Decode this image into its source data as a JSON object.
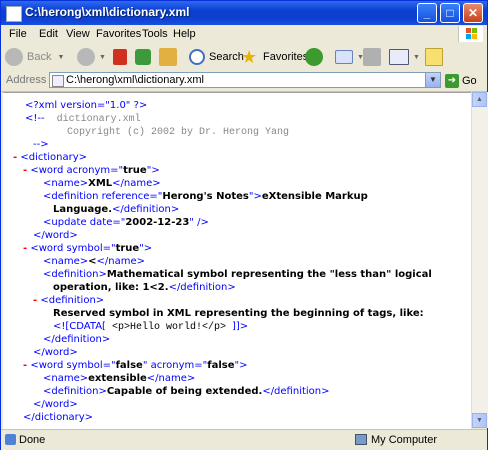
{
  "window": {
    "title": "C:\\herong\\xml\\dictionary.xml"
  },
  "menu": [
    "File",
    "Edit",
    "View",
    "Favorites",
    "Tools",
    "Help"
  ],
  "toolbar": {
    "back_label": "Back",
    "search_label": "Search",
    "favorites_label": "Favorites"
  },
  "address": {
    "label": "Address",
    "value": "C:\\herong\\xml\\dictionary.xml",
    "go_label": "Go"
  },
  "xml": {
    "l1": "<?xml version=\"1.0\" ?>",
    "l2_open": "<!--",
    "l2_text": "  dictionary.xml",
    "l3_text": "   Copyright (c) 2002 by Dr. Herong Yang",
    "l4_close": "-->",
    "dictionary_open": "<dictionary>",
    "word_acronym_open": "<word acronym=\"",
    "word_acronym_val": "true",
    "tag_close": "\">",
    "name_open": "<name>",
    "name_close": "</name>",
    "xml_word": "XML",
    "def_ref_open": "<definition reference=\"",
    "def_ref_val": "Herong's Notes",
    "def_open_tail": "\">",
    "def1_text_a": "eXtensible Markup",
    "def1_text_b": "Language.",
    "def_close": "</definition>",
    "update_open": "<update date=\"",
    "update_val": "2002-12-23",
    "update_close": "\" />",
    "word_close": "</word>",
    "word_symbol_open": "<word symbol=\"",
    "word_symbol_val": "true",
    "name2_text": "<",
    "def_open": "<definition>",
    "def2_text_a": "Mathematical symbol representing the \"less than\" logical",
    "def2_text_b": "operation, like: 1<2.",
    "def3_text": "Reserved symbol in XML representing the beginning of tags, like:",
    "cdata_open": "<![CDATA[",
    "cdata_text": " <p>Hello world!</p> ",
    "cdata_close": "]]>",
    "word3_open": "<word symbol=\"",
    "word3_symbol_val": "false",
    "word3_mid": "\" acronym=\"",
    "word3_acronym_val": "false",
    "name3_text": "extensible",
    "def4_text": "Capable of being extended.",
    "dictionary_close": "</dictionary>",
    "minus": "-"
  },
  "status": {
    "text": "Done",
    "zone": "My Computer"
  }
}
